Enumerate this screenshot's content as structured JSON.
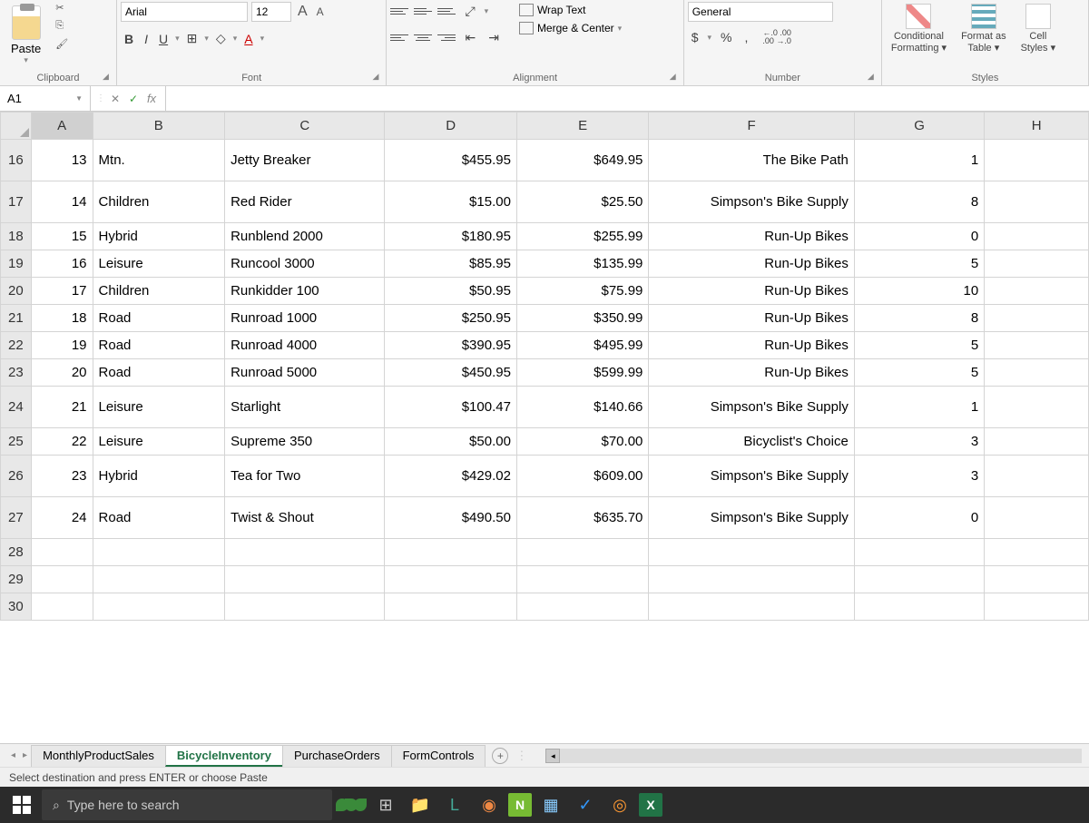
{
  "ribbon": {
    "clipboard": {
      "paste": "Paste",
      "label": "Clipboard"
    },
    "font": {
      "name": "Arial",
      "size": "12",
      "label": "Font"
    },
    "alignment": {
      "wrap": "Wrap Text",
      "merge": "Merge & Center",
      "label": "Alignment"
    },
    "number": {
      "format": "General",
      "label": "Number"
    },
    "styles": {
      "cond1": "Conditional",
      "cond2": "Formatting",
      "fmt1": "Format as",
      "fmt2": "Table",
      "cell1": "Cell",
      "cell2": "Styles",
      "label": "Styles"
    }
  },
  "formula_bar": {
    "name_box": "A1",
    "fx": "fx"
  },
  "columns": [
    "A",
    "B",
    "C",
    "D",
    "E",
    "F",
    "G",
    "H"
  ],
  "rows": [
    {
      "n": "16",
      "tall": true,
      "A": "13",
      "B": "Mtn.",
      "C": "Jetty Breaker",
      "D": "$455.95",
      "E": "$649.95",
      "F": "The Bike Path",
      "G": "1"
    },
    {
      "n": "17",
      "tall": true,
      "A": "14",
      "B": "Children",
      "C": "Red Rider",
      "D": "$15.00",
      "E": "$25.50",
      "F": "Simpson's Bike Supply",
      "G": "8"
    },
    {
      "n": "18",
      "A": "15",
      "B": "Hybrid",
      "C": "Runblend 2000",
      "D": "$180.95",
      "E": "$255.99",
      "F": "Run-Up Bikes",
      "G": "0"
    },
    {
      "n": "19",
      "A": "16",
      "B": "Leisure",
      "C": "Runcool 3000",
      "D": "$85.95",
      "E": "$135.99",
      "F": "Run-Up Bikes",
      "G": "5"
    },
    {
      "n": "20",
      "A": "17",
      "B": "Children",
      "C": "Runkidder 100",
      "D": "$50.95",
      "E": "$75.99",
      "F": "Run-Up Bikes",
      "G": "10"
    },
    {
      "n": "21",
      "A": "18",
      "B": "Road",
      "C": "Runroad 1000",
      "D": "$250.95",
      "E": "$350.99",
      "F": "Run-Up Bikes",
      "G": "8"
    },
    {
      "n": "22",
      "A": "19",
      "B": "Road",
      "C": "Runroad 4000",
      "D": "$390.95",
      "E": "$495.99",
      "F": "Run-Up Bikes",
      "G": "5"
    },
    {
      "n": "23",
      "A": "20",
      "B": "Road",
      "C": "Runroad 5000",
      "D": "$450.95",
      "E": "$599.99",
      "F": "Run-Up Bikes",
      "G": "5"
    },
    {
      "n": "24",
      "tall": true,
      "A": "21",
      "B": "Leisure",
      "C": "Starlight",
      "D": "$100.47",
      "E": "$140.66",
      "F": "Simpson's Bike Supply",
      "G": "1"
    },
    {
      "n": "25",
      "A": "22",
      "B": "Leisure",
      "C": "Supreme 350",
      "D": "$50.00",
      "E": "$70.00",
      "F": "Bicyclist's Choice",
      "G": "3"
    },
    {
      "n": "26",
      "tall": true,
      "A": "23",
      "B": "Hybrid",
      "C": "Tea for Two",
      "D": "$429.02",
      "E": "$609.00",
      "F": "Simpson's Bike Supply",
      "G": "3"
    },
    {
      "n": "27",
      "tall": true,
      "A": "24",
      "B": "Road",
      "C": "Twist & Shout",
      "D": "$490.50",
      "E": "$635.70",
      "F": "Simpson's Bike Supply",
      "G": "0"
    },
    {
      "n": "28"
    },
    {
      "n": "29"
    },
    {
      "n": "30"
    }
  ],
  "sheets": {
    "tabs": [
      "MonthlyProductSales",
      "BicycleInventory",
      "PurchaseOrders",
      "FormControls"
    ],
    "active": 1
  },
  "status": "Select destination and press ENTER or choose Paste",
  "taskbar": {
    "search_placeholder": "Type here to search"
  }
}
